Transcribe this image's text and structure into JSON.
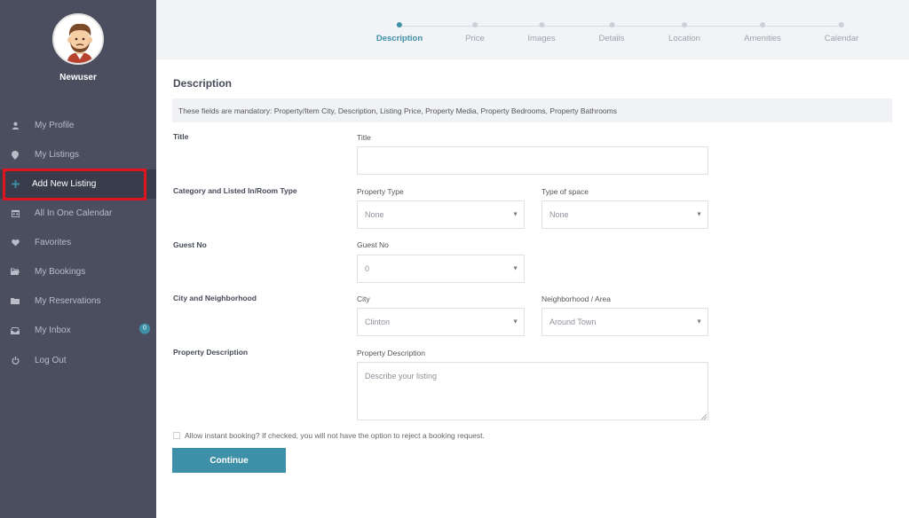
{
  "user": {
    "name": "Newuser"
  },
  "sidebar": {
    "items": [
      {
        "label": "My Profile",
        "icon": "user-icon"
      },
      {
        "label": "My Listings",
        "icon": "map-marker-icon"
      },
      {
        "label": "Add New Listing",
        "icon": "plus-icon",
        "active": true
      },
      {
        "label": "All In One Calendar",
        "icon": "calendar-icon"
      },
      {
        "label": "Favorites",
        "icon": "heart-icon"
      },
      {
        "label": "My Bookings",
        "icon": "folder-open-icon"
      },
      {
        "label": "My Reservations",
        "icon": "folder-icon"
      },
      {
        "label": "My Inbox",
        "icon": "inbox-icon",
        "badge": "0"
      },
      {
        "label": "Log Out",
        "icon": "power-icon"
      }
    ]
  },
  "steps": [
    {
      "label": "Description",
      "active": true
    },
    {
      "label": "Price"
    },
    {
      "label": "Images"
    },
    {
      "label": "Details"
    },
    {
      "label": "Location"
    },
    {
      "label": "Amenities"
    },
    {
      "label": "Calendar"
    }
  ],
  "form": {
    "section_title": "Description",
    "notice": "These fields are mandatory: Property/Item City, Description, Listing Price, Property Media, Property Bedrooms, Property Bathrooms",
    "title_row": {
      "label": "Title",
      "field_label": "Title",
      "value": ""
    },
    "category_row": {
      "label": "Category and Listed In/Room Type",
      "property_type": {
        "label": "Property Type",
        "value": "None"
      },
      "type_of_space": {
        "label": "Type of space",
        "value": "None"
      }
    },
    "guest_row": {
      "label": "Guest No",
      "field_label": "Guest No",
      "value": "0"
    },
    "city_row": {
      "label": "City and Neighborhood",
      "city": {
        "label": "City",
        "value": "Clinton"
      },
      "neighborhood": {
        "label": "Neighborhood / Area",
        "value": "Around Town"
      }
    },
    "description_row": {
      "label": "Property Description",
      "field_label": "Property Description",
      "placeholder": "Describe your listing"
    },
    "instant_booking": "Allow instant booking? If checked, you will not have the option to reject a booking request.",
    "continue_label": "Continue"
  },
  "colors": {
    "accent": "#3e8fa8",
    "sidebar_bg": "#4a4e5f",
    "highlight": "#e0141c"
  }
}
